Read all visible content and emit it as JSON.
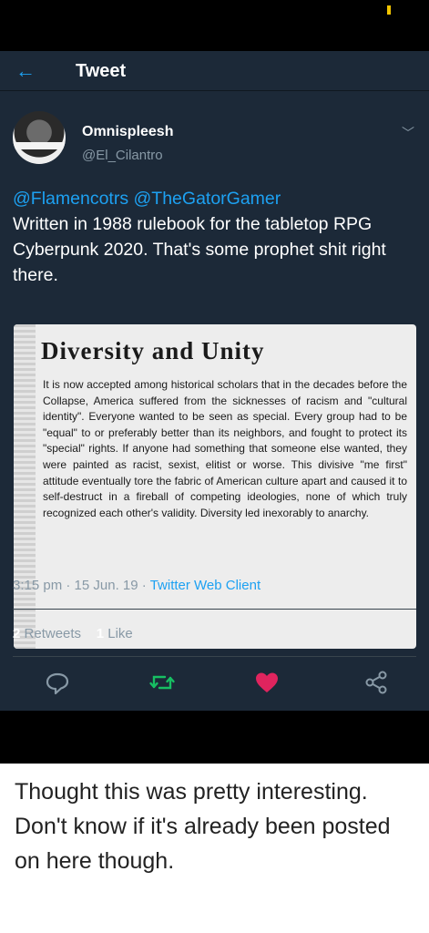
{
  "app": {
    "title": "Tweet"
  },
  "tweet": {
    "display_name": "Omnispleesh",
    "handle": "@El_Cilantro",
    "mentions": [
      "@Flamencotrs",
      "@TheGatorGamer"
    ],
    "text": "Written in 1988 rulebook for the tabletop RPG Cyberpunk 2020. That's some prophet shit right there.",
    "media": {
      "title": "Diversity and Unity",
      "body": "It is now accepted among historical scholars that in the decades before the Collapse, America suffered from the sicknesses of racism and \"cultural identity\". Everyone wanted to be seen as special. Every group had to be \"equal\" to or preferably better than its neighbors, and fought to protect its \"special\" rights. If anyone had something that someone else wanted, they were painted as racist, sexist, elitist or worse. This divisive \"me first\" attitude eventually tore the fabric of American culture apart and caused it to self-destruct in a fireball of competing ideologies, none of which truly recognized each other's validity. Diversity led inexorably to anarchy."
    },
    "time": "3:15 pm",
    "date": "15 Jun. 19",
    "separator": "·",
    "client": "Twitter Web Client",
    "retweets_count": "2",
    "retweets_label": "Retweets",
    "likes_count": "1",
    "likes_label": "Like",
    "liked": true
  },
  "actions": [
    {
      "name": "reply",
      "icon": "reply-icon"
    },
    {
      "name": "retweet",
      "icon": "retweet-icon"
    },
    {
      "name": "like",
      "icon": "heart-icon"
    },
    {
      "name": "share",
      "icon": "share-icon"
    }
  ],
  "caption": "Thought this was pretty interesting. Don't know if it's already been posted on here though.",
  "colors": {
    "background": "#1c2938",
    "accent": "#1da1f2",
    "muted": "#8899a6",
    "retweet": "#17bf63",
    "like": "#e0245e"
  }
}
